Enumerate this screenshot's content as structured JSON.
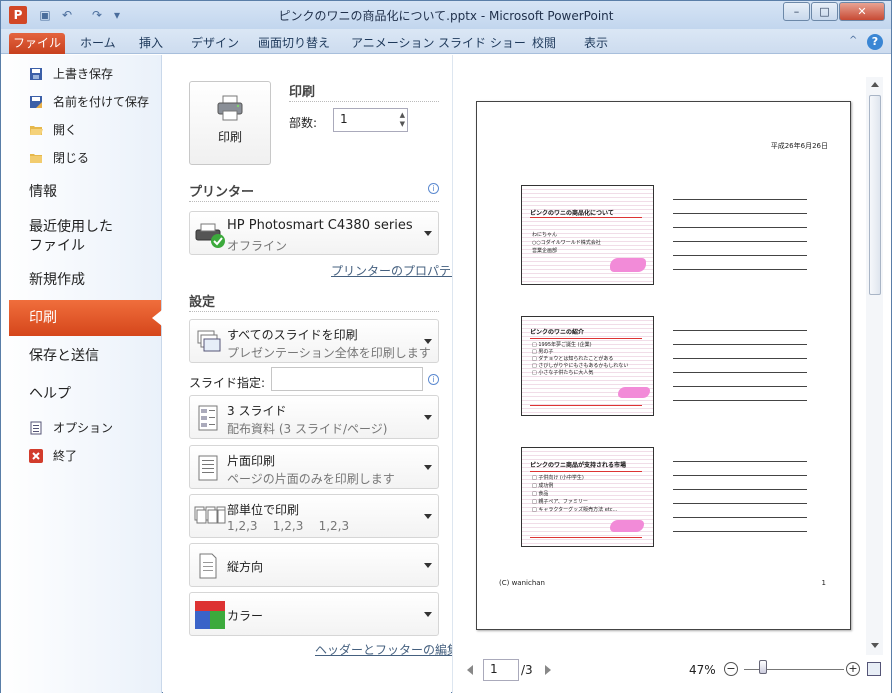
{
  "window": {
    "title": "ピンクのワニの商品化について.pptx - Microsoft PowerPoint",
    "app_letter": "P",
    "buttons": {
      "minimize": "–",
      "maximize": "□",
      "close": "✕"
    },
    "qat_icons": [
      "save-icon",
      "undo-icon",
      "redo-icon",
      "customize-qat-icon"
    ]
  },
  "ribbon": {
    "tabs": [
      "ファイル",
      "ホーム",
      "挿入",
      "デザイン",
      "画面切り替え",
      "アニメーション",
      "スライド ショー",
      "校閲",
      "表示"
    ],
    "help": "?",
    "minimize_icon": "^"
  },
  "sidebar": {
    "small_top": [
      {
        "label": "上書き保存",
        "icon": "save-icon"
      },
      {
        "label": "名前を付けて保存",
        "icon": "save-as-icon"
      },
      {
        "label": "開く",
        "icon": "open-folder-icon"
      },
      {
        "label": "閉じる",
        "icon": "close-folder-icon"
      }
    ],
    "large": [
      "情報",
      "最近使用した\nファイル",
      "新規作成",
      "印刷",
      "保存と送信",
      "ヘルプ"
    ],
    "recent_line1": "最近使用した",
    "recent_line2": "ファイル",
    "small_bottom": [
      {
        "label": "オプション",
        "icon": "options-icon"
      },
      {
        "label": "終了",
        "icon": "exit-icon"
      }
    ],
    "selected": "印刷"
  },
  "print": {
    "heading": "印刷",
    "button_label": "印刷",
    "copies_label": "部数:",
    "copies_value": "1"
  },
  "printer": {
    "heading": "プリンター",
    "name": "HP Photosmart C4380 series",
    "status": "オフライン",
    "properties_link": "プリンターのプロパティ"
  },
  "settings": {
    "heading": "設定",
    "slides_label": "スライド指定:",
    "slides_value": "",
    "dropdowns": [
      {
        "title": "すべてのスライドを印刷",
        "sub": "プレゼンテーション全体を印刷します",
        "icon": "print-all-slides-icon"
      },
      {
        "title": "3 スライド",
        "sub": "配布資料 (3 スライド/ページ)",
        "icon": "handout-3-slides-icon"
      },
      {
        "title": "片面印刷",
        "sub": "ページの片面のみを印刷します",
        "icon": "single-sided-icon"
      },
      {
        "title": "部単位で印刷",
        "sub": "1,2,3    1,2,3    1,2,3",
        "icon": "collated-icon"
      },
      {
        "title": "縦方向",
        "sub": "",
        "icon": "portrait-icon"
      },
      {
        "title": "カラー",
        "sub": "",
        "icon": "color-icon"
      }
    ],
    "header_footer_link": "ヘッダーとフッターの編集"
  },
  "preview": {
    "date": "平成26年6月26日",
    "footer": "(C) wanichan",
    "page_number": "1",
    "slides": [
      {
        "title": "ピンクのワニの商品化について",
        "items": [
          "わにちゃん",
          "○○コダイルワールド株式会社",
          "営業企画部"
        ]
      },
      {
        "title": "ピンクのワニの紹介",
        "items": [
          "□ 1995年夢ご誕生 (企業)",
          "□ 男の子",
          "□ ダチョウとは知られたことがある",
          "□ さびしがりやにもさもあるかもしれない",
          "□ 小さな子供たちに大人気"
        ]
      },
      {
        "title": "ピンクのワニ商品が支持される市場",
        "items": [
          "□ 子供向け (小中学生)",
          "□ 成功例",
          "□ 食品",
          "□ 親子ペア、ファミリー",
          "□ キャラクターグッズ販売方法 etc..."
        ]
      }
    ]
  },
  "nav": {
    "current_page": "1",
    "total_pages": "/3",
    "zoom": "47%",
    "zoom_minus": "−",
    "zoom_plus": "+",
    "zoom_level": 0.47
  }
}
